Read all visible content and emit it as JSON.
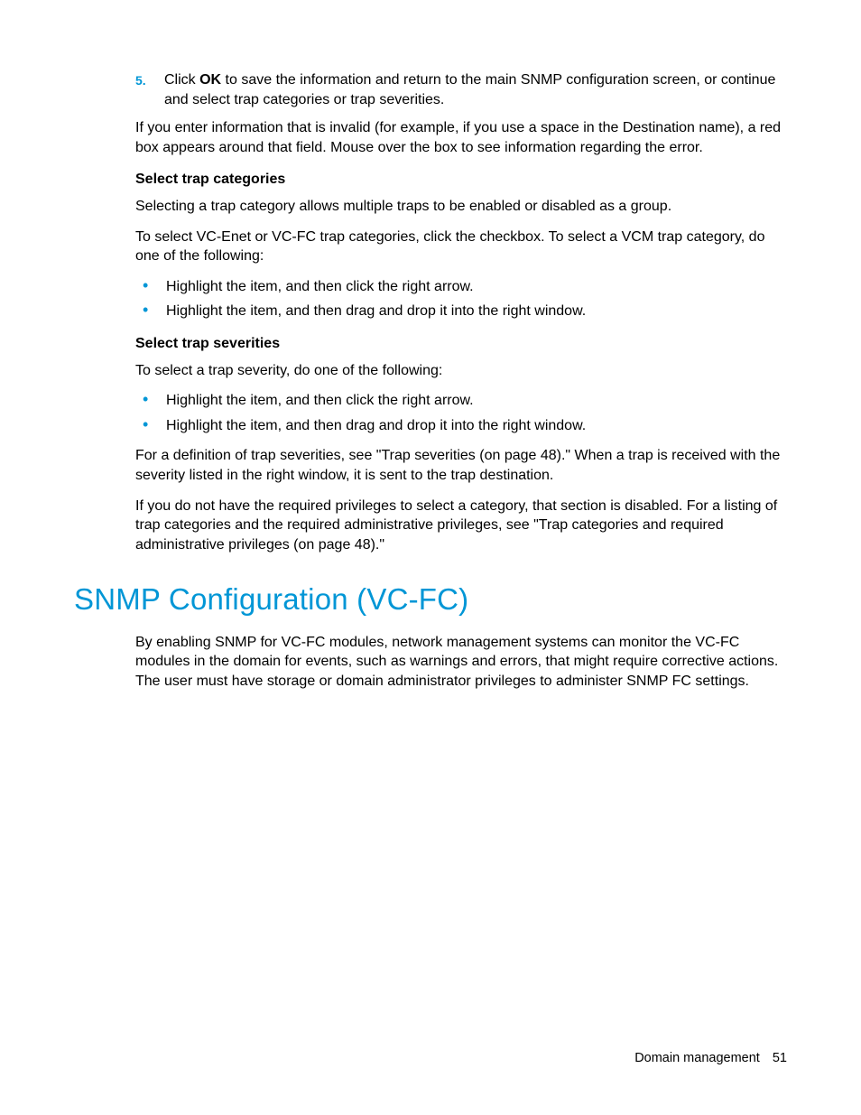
{
  "step5": {
    "number": "5.",
    "prefix": "Click ",
    "bold": "OK",
    "suffix": " to save the information and return to the main SNMP configuration screen, or continue and select trap categories or trap severities."
  },
  "para_invalid": "If you enter information that is invalid (for example, if you use a space in the Destination name), a red box appears around that field. Mouse over the box to see information regarding the error.",
  "trap_categories": {
    "heading": "Select trap categories",
    "p1": "Selecting a trap category allows multiple traps to be enabled or disabled as a group.",
    "p2": "To select VC-Enet or VC-FC trap categories, click the checkbox. To select a VCM trap category, do one of the following:",
    "items": [
      "Highlight the item, and then click the right arrow.",
      "Highlight the item, and then drag and drop it into the right window."
    ]
  },
  "trap_severities": {
    "heading": "Select trap severities",
    "p1": "To select a trap severity, do one of the following:",
    "items": [
      "Highlight the item, and then click the right arrow.",
      "Highlight the item, and then drag and drop it into the right window."
    ],
    "p2": "For a definition of trap severities, see \"Trap severities (on page 48).\" When a trap is received with the severity listed in the right window, it is sent to the trap destination.",
    "p3": "If you do not have the required privileges to select a category, that section is disabled. For a listing of trap categories and the required administrative privileges, see \"Trap categories and required administrative privileges (on page 48).\""
  },
  "section": {
    "title": "SNMP Configuration (VC-FC)",
    "body": "By enabling SNMP for VC-FC modules, network management systems can monitor the VC-FC modules in the domain for events, such as warnings and errors, that might require corrective actions. The user must have storage or domain administrator privileges to administer SNMP FC settings."
  },
  "footer": {
    "label": "Domain management",
    "page": "51"
  }
}
